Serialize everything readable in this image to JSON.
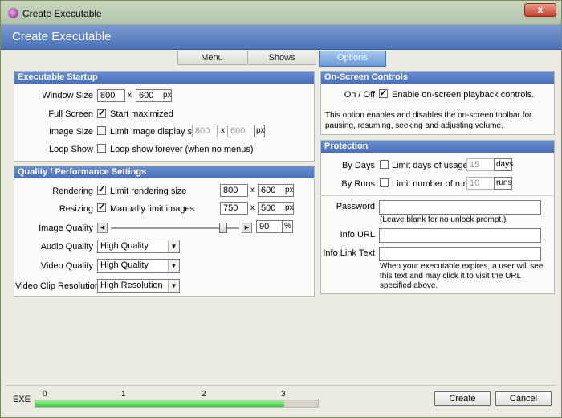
{
  "window": {
    "title": "Create Executable",
    "close_label": "x"
  },
  "header": {
    "title": "Create Executable"
  },
  "tabs": [
    {
      "label": "Menu"
    },
    {
      "label": "Shows"
    },
    {
      "label": "Options"
    }
  ],
  "startup": {
    "heading": "Executable Startup",
    "window_size_label": "Window Size",
    "window_w": "800",
    "window_h": "600",
    "px": "px",
    "x": "x",
    "full_screen_label": "Full Screen",
    "start_maximized": "Start maximized",
    "start_maximized_checked": "✓",
    "image_size_label": "Image Size",
    "limit_image_display": "Limit image display size",
    "img_w": "800",
    "img_h": "600",
    "loop_show_label": "Loop Show",
    "loop_forever": "Loop show forever (when no menus)"
  },
  "quality": {
    "heading": "Quality / Performance Settings",
    "rendering_label": "Rendering",
    "limit_rendering": "Limit rendering size",
    "rendering_checked": "✓",
    "rend_w": "800",
    "rend_h": "600",
    "resizing_label": "Resizing",
    "manually_limit": "Manually limit images",
    "resizing_checked": "✓",
    "res_w": "750",
    "res_h": "500",
    "image_quality_label": "Image Quality",
    "image_quality_value": "90",
    "image_quality_fraction": 0.9,
    "percent": "%",
    "audio_label": "Audio Quality",
    "audio_value": "High Quality",
    "video_label": "Video Quality",
    "video_value": "High Quality",
    "clip_label": "Video Clip Resolution",
    "clip_value": "High Resolution"
  },
  "onscreen": {
    "heading": "On-Screen Controls",
    "onoff_label": "On / Off",
    "enable_label": "Enable on-screen playback controls.",
    "enable_checked": "✓",
    "description": "This option enables and disables the on-screen toolbar for pausing, resuming, seeking and adjusting volume."
  },
  "protection": {
    "heading": "Protection",
    "bydays_label": "By Days",
    "limit_days": "Limit days of usage",
    "days_value": "15",
    "days_unit": "days",
    "byruns_label": "By Runs",
    "limit_runs": "Limit number of runs",
    "runs_value": "10",
    "runs_unit": "runs",
    "password_label": "Password",
    "password_hint": "(Leave blank for no unlock prompt.)",
    "info_url_label": "Info URL",
    "info_link_label": "Info Link Text",
    "info_link_hint": "When your executable expires, a user will see this text and may click it to visit the URL specified above."
  },
  "footer": {
    "exe_label": "EXE",
    "ticks": [
      "0",
      "1",
      "2",
      "3"
    ],
    "progress_fraction": 0.88,
    "create_label": "Create",
    "cancel_label": "Cancel"
  }
}
